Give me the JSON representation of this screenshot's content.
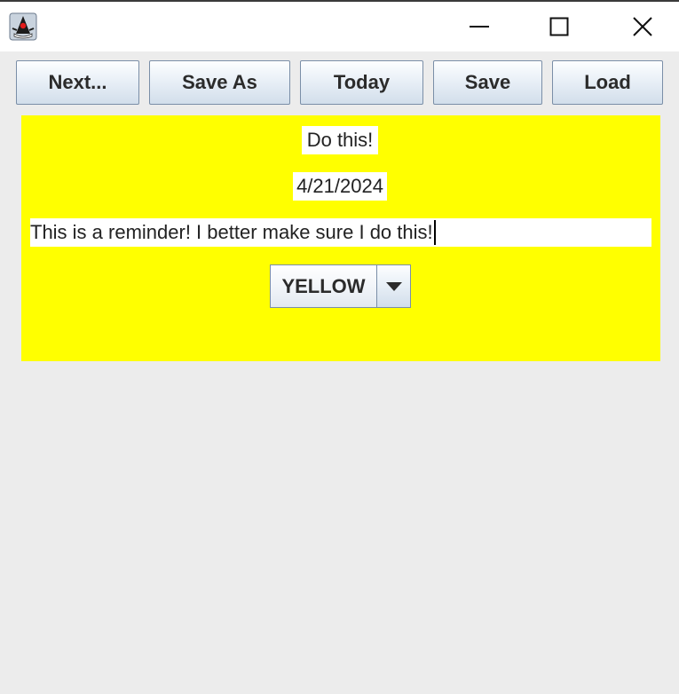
{
  "window": {
    "icon": "java-duke-icon"
  },
  "toolbar": {
    "next_label": "Next...",
    "save_as_label": "Save As",
    "today_label": "Today",
    "save_label": "Save",
    "load_label": "Load"
  },
  "note": {
    "background_color": "#ffff00",
    "title": "Do this!",
    "date": "4/21/2024",
    "reminder": "This is a reminder! I better make sure I do this!",
    "color_select": {
      "selected": "YELLOW"
    }
  }
}
